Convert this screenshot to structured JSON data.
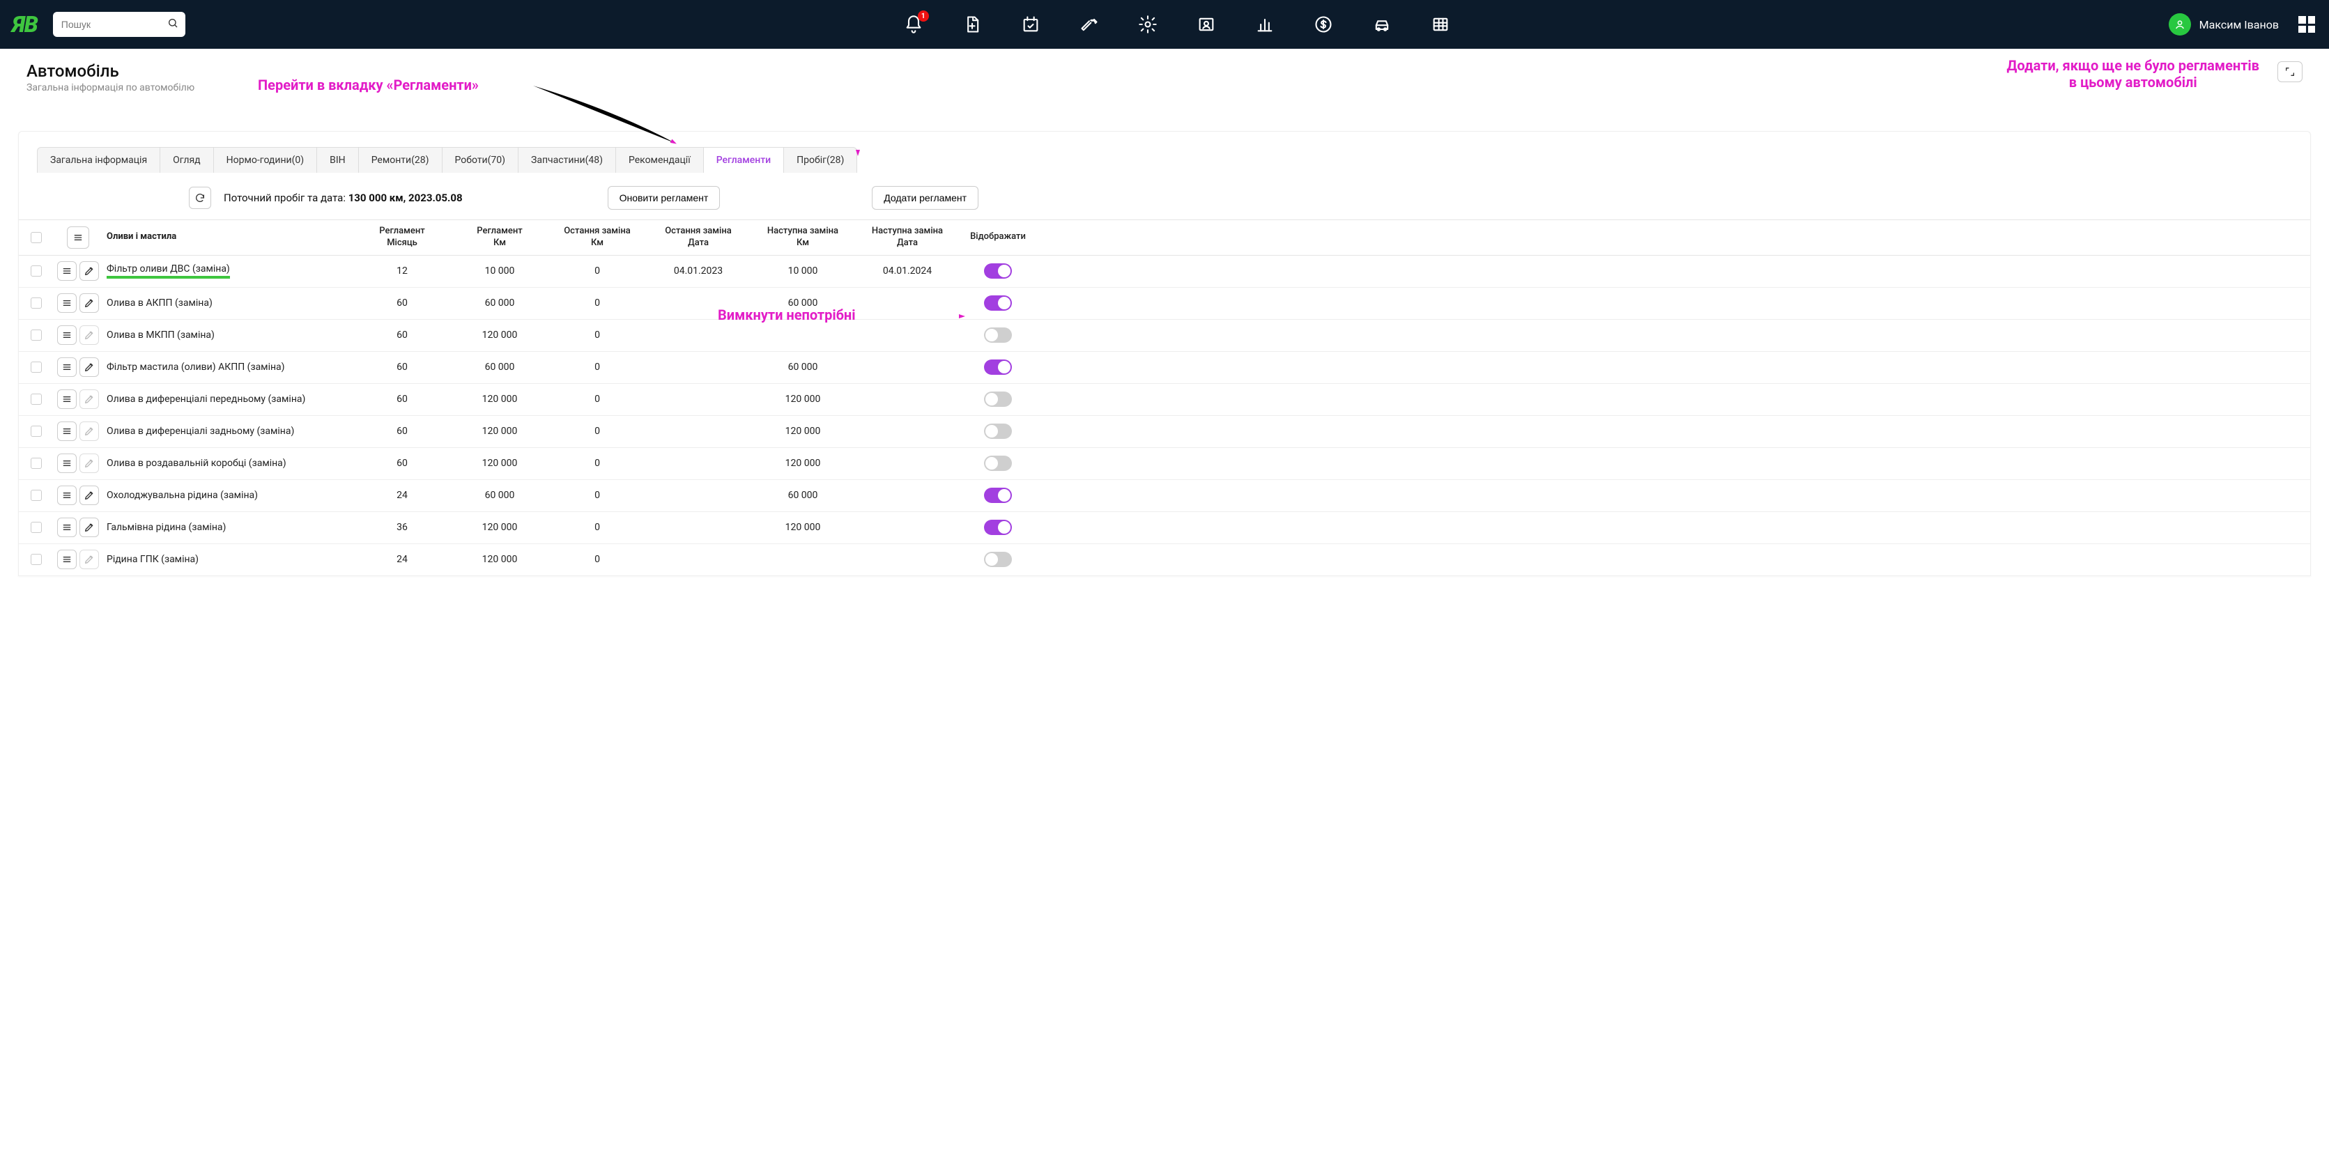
{
  "search_placeholder": "Пошук",
  "bell_badge": "1",
  "user_name": "Максим Іванов",
  "page": {
    "title": "Автомобіль",
    "subtitle": "Загальна інформація по автомобілю"
  },
  "annotations": {
    "goto_tab": "Перейти в вкладку «Регламенти»",
    "add_line1": "Додати, якщо ще не було регламентів",
    "add_line2": "в цьому автомобілі",
    "disable": "Вимкнути непотрібні"
  },
  "tabs": [
    {
      "label": "Загальна інформація"
    },
    {
      "label": "Огляд"
    },
    {
      "label": "Нормо-години(0)"
    },
    {
      "label": "BIH"
    },
    {
      "label": "Ремонти(28)"
    },
    {
      "label": "Роботи(70)"
    },
    {
      "label": "Запчастини(48)"
    },
    {
      "label": "Рекомендації"
    },
    {
      "label": "Регламенти",
      "active": true
    },
    {
      "label": "Пробіг(28)"
    }
  ],
  "actionbar": {
    "mileage_label": "Поточний пробіг та дата: ",
    "mileage_value": "130 000 км, 2023.05.08",
    "update_btn": "Оновити регламент",
    "add_btn": "Додати регламент"
  },
  "columns": {
    "name": "Оливи і мастила",
    "reg_month_1": "Регламент",
    "reg_month_2": "Місяць",
    "reg_km_1": "Регламент",
    "reg_km_2": "Км",
    "last_km_1": "Остання заміна",
    "last_km_2": "Км",
    "last_date_1": "Остання заміна",
    "last_date_2": "Дата",
    "next_km_1": "Наступна заміна",
    "next_km_2": "Км",
    "next_date_1": "Наступна заміна",
    "next_date_2": "Дата",
    "show": "Відображати"
  },
  "rows": [
    {
      "name": "Фільтр оливи ДВС (заміна)",
      "month": "12",
      "km": "10 000",
      "last_km": "0",
      "last_date": "04.01.2023",
      "next_km": "10 000",
      "next_date": "04.01.2024",
      "on": true,
      "highlight": true,
      "edit": true
    },
    {
      "name": "Олива в АКПП (заміна)",
      "month": "60",
      "km": "60 000",
      "last_km": "0",
      "last_date": "",
      "next_km": "60 000",
      "next_date": "",
      "on": true,
      "edit": true
    },
    {
      "name": "Олива в МКПП (заміна)",
      "month": "60",
      "km": "120 000",
      "last_km": "0",
      "last_date": "",
      "next_km": "",
      "next_date": "",
      "on": false,
      "edit": false
    },
    {
      "name": "Фільтр мастила (оливи) АКПП (заміна)",
      "month": "60",
      "km": "60 000",
      "last_km": "0",
      "last_date": "",
      "next_km": "60 000",
      "next_date": "",
      "on": true,
      "edit": true
    },
    {
      "name": "Олива в диференціалі передньому (заміна)",
      "month": "60",
      "km": "120 000",
      "last_km": "0",
      "last_date": "",
      "next_km": "120 000",
      "next_date": "",
      "on": false,
      "edit": false
    },
    {
      "name": "Олива в диференціалі задньому (заміна)",
      "month": "60",
      "km": "120 000",
      "last_km": "0",
      "last_date": "",
      "next_km": "120 000",
      "next_date": "",
      "on": false,
      "edit": false
    },
    {
      "name": "Олива в роздавальній коробці (заміна)",
      "month": "60",
      "km": "120 000",
      "last_km": "0",
      "last_date": "",
      "next_km": "120 000",
      "next_date": "",
      "on": false,
      "edit": false
    },
    {
      "name": "Охолоджувальна рідина (заміна)",
      "month": "24",
      "km": "60 000",
      "last_km": "0",
      "last_date": "",
      "next_km": "60 000",
      "next_date": "",
      "on": true,
      "edit": true
    },
    {
      "name": "Гальмівна рідина (заміна)",
      "month": "36",
      "km": "120 000",
      "last_km": "0",
      "last_date": "",
      "next_km": "120 000",
      "next_date": "",
      "on": true,
      "edit": true
    },
    {
      "name": "Рідина ГПК (заміна)",
      "month": "24",
      "km": "120 000",
      "last_km": "0",
      "last_date": "",
      "next_km": "",
      "next_date": "",
      "on": false,
      "edit": false
    }
  ]
}
